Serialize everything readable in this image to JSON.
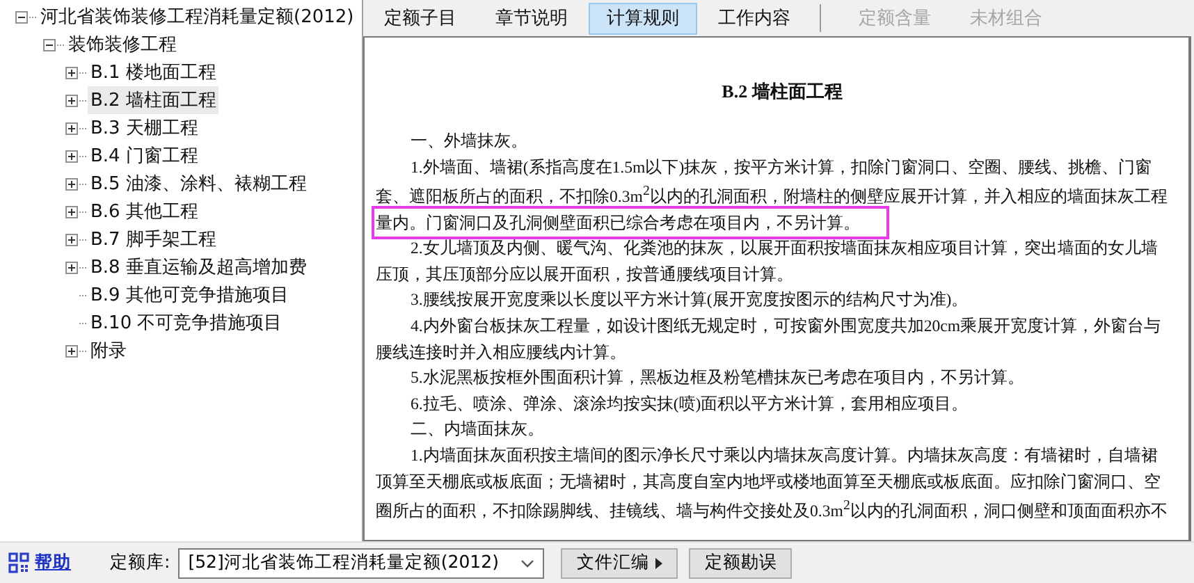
{
  "tree": {
    "label": "河北省装饰装修工程消耗量定额(2012)",
    "expanded": true,
    "children": [
      {
        "label": "装饰装修工程",
        "expanded": true,
        "children": [
          {
            "label": "B.1 楼地面工程",
            "kind": "group",
            "expanded": false,
            "selected": false
          },
          {
            "label": "B.2 墙柱面工程",
            "kind": "group",
            "expanded": false,
            "selected": true
          },
          {
            "label": "B.3 天棚工程",
            "kind": "group",
            "expanded": false,
            "selected": false
          },
          {
            "label": "B.4 门窗工程",
            "kind": "group",
            "expanded": false,
            "selected": false
          },
          {
            "label": "B.5 油漆、涂料、裱糊工程",
            "kind": "group",
            "expanded": false,
            "selected": false
          },
          {
            "label": "B.6 其他工程",
            "kind": "group",
            "expanded": false,
            "selected": false
          },
          {
            "label": "B.7 脚手架工程",
            "kind": "group",
            "expanded": false,
            "selected": false
          },
          {
            "label": "B.8 垂直运输及超高增加费",
            "kind": "group",
            "expanded": false,
            "selected": false
          },
          {
            "label": "B.9 其他可竞争措施项目",
            "kind": "leaf",
            "selected": false
          },
          {
            "label": "B.10 不可竞争措施项目",
            "kind": "leaf",
            "selected": false
          },
          {
            "label": "附录",
            "kind": "group",
            "expanded": false,
            "selected": false
          }
        ]
      }
    ]
  },
  "tabs": [
    {
      "label": "定额子目",
      "selected": false,
      "disabled": false
    },
    {
      "label": "章节说明",
      "selected": false,
      "disabled": false
    },
    {
      "label": "计算规则",
      "selected": true,
      "disabled": false
    },
    {
      "label": "工作内容",
      "selected": false,
      "disabled": false
    },
    {
      "label": "定额含量",
      "selected": false,
      "disabled": true
    },
    {
      "label": "未材组合",
      "selected": false,
      "disabled": true
    }
  ],
  "document": {
    "title": "B.2 墙柱面工程",
    "lines": [
      {
        "kind": "indent",
        "text": "一、外墙抹灰。",
        "highlighted": false
      },
      {
        "kind": "indent",
        "text": "1.外墙面、墙裙(系指高度在1.5m以下)抹灰，按平方米计算，扣除门窗洞口、空圈、腰线、挑檐、门窗",
        "highlighted": false
      },
      {
        "kind": "plain",
        "text": "套、遮阳板所占的面积，不扣除0.3m$^{2}$以内的孔洞面积，附墙柱的侧壁应展开计算，并入相应的墙面抹灰工程",
        "highlighted": false
      },
      {
        "kind": "plain",
        "text": "量内。门窗洞口及孔洞侧壁面积已综合考虑在项目内，不另计算。",
        "highlighted": true
      },
      {
        "kind": "indent",
        "text": "2.女儿墙顶及内侧、暖气沟、化粪池的抹灰，以展开面积按墙面抹灰相应项目计算，突出墙面的女儿墙",
        "highlighted": false
      },
      {
        "kind": "plain",
        "text": "压顶，其压顶部分应以展开面积，按普通腰线项目计算。",
        "highlighted": false
      },
      {
        "kind": "indent",
        "text": "3.腰线按展开宽度乘以长度以平方米计算(展开宽度按图示的结构尺寸为准)。",
        "highlighted": false
      },
      {
        "kind": "indent",
        "text": "4.内外窗台板抹灰工程量，如设计图纸无规定时，可按窗外围宽度共加20cm乘展开宽度计算，外窗台与",
        "highlighted": false
      },
      {
        "kind": "plain",
        "text": "腰线连接时并入相应腰线内计算。",
        "highlighted": false
      },
      {
        "kind": "indent",
        "text": "5.水泥黑板按框外围面积计算，黑板边框及粉笔槽抹灰已考虑在项目内，不另计算。",
        "highlighted": false
      },
      {
        "kind": "indent",
        "text": "6.拉毛、喷涂、弹涂、滚涂均按实抹(喷)面积以平方米计算，套用相应项目。",
        "highlighted": false
      },
      {
        "kind": "indent",
        "text": "二、内墙面抹灰。",
        "highlighted": false
      },
      {
        "kind": "indent",
        "text": "1.内墙面抹灰面积按主墙间的图示净长尺寸乘以内墙抹灰高度计算。内墙抹灰高度：有墙裙时，自墙裙",
        "highlighted": false
      },
      {
        "kind": "plain",
        "text": "顶算至天棚底或板底面；无墙裙时，其高度自室内地坪或楼地面算至天棚底或板底面。应扣除门窗洞口、空",
        "highlighted": false
      },
      {
        "kind": "plain",
        "text": "圈所占的面积，不扣除踢脚线、挂镜线、墙与构件交接处及0.3m$^{2}$以内的孔洞面积，洞口侧壁和顶面面积亦不",
        "highlighted": false
      }
    ]
  },
  "footer": {
    "help": "帮助",
    "library_label": "定额库:",
    "library_value": "[52]河北省装饰工程消耗量定额(2012)",
    "buttons": [
      {
        "label": "文件汇编",
        "kind": "menu"
      },
      {
        "label": "定额勘误",
        "kind": "plain"
      }
    ]
  }
}
